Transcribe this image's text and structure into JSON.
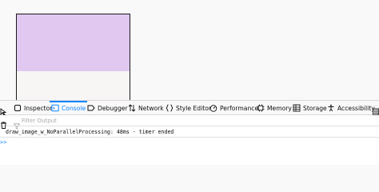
{
  "devtools": {
    "tabs": [
      {
        "label": "Inspector",
        "icon": "inspector-icon"
      },
      {
        "label": "Console",
        "icon": "console-icon",
        "selected": true
      },
      {
        "label": "Debugger",
        "icon": "debugger-icon"
      },
      {
        "label": "Network",
        "icon": "network-icon"
      },
      {
        "label": "Style Editor",
        "icon": "style-editor-icon"
      },
      {
        "label": "Performance",
        "icon": "performance-icon"
      },
      {
        "label": "Memory",
        "icon": "memory-icon"
      },
      {
        "label": "Storage",
        "icon": "storage-icon"
      },
      {
        "label": "Accessibility",
        "icon": "accessibility-icon"
      }
    ],
    "filter": {
      "placeholder": "Filter Output"
    },
    "console": {
      "messages": [
        "draw_image_w_NoParallelProcessing: 48ms - timer ended"
      ],
      "prompt": ">>"
    },
    "colors": {
      "accent": "#0a84ff",
      "canvas_fill": "#e0c8f1"
    }
  }
}
